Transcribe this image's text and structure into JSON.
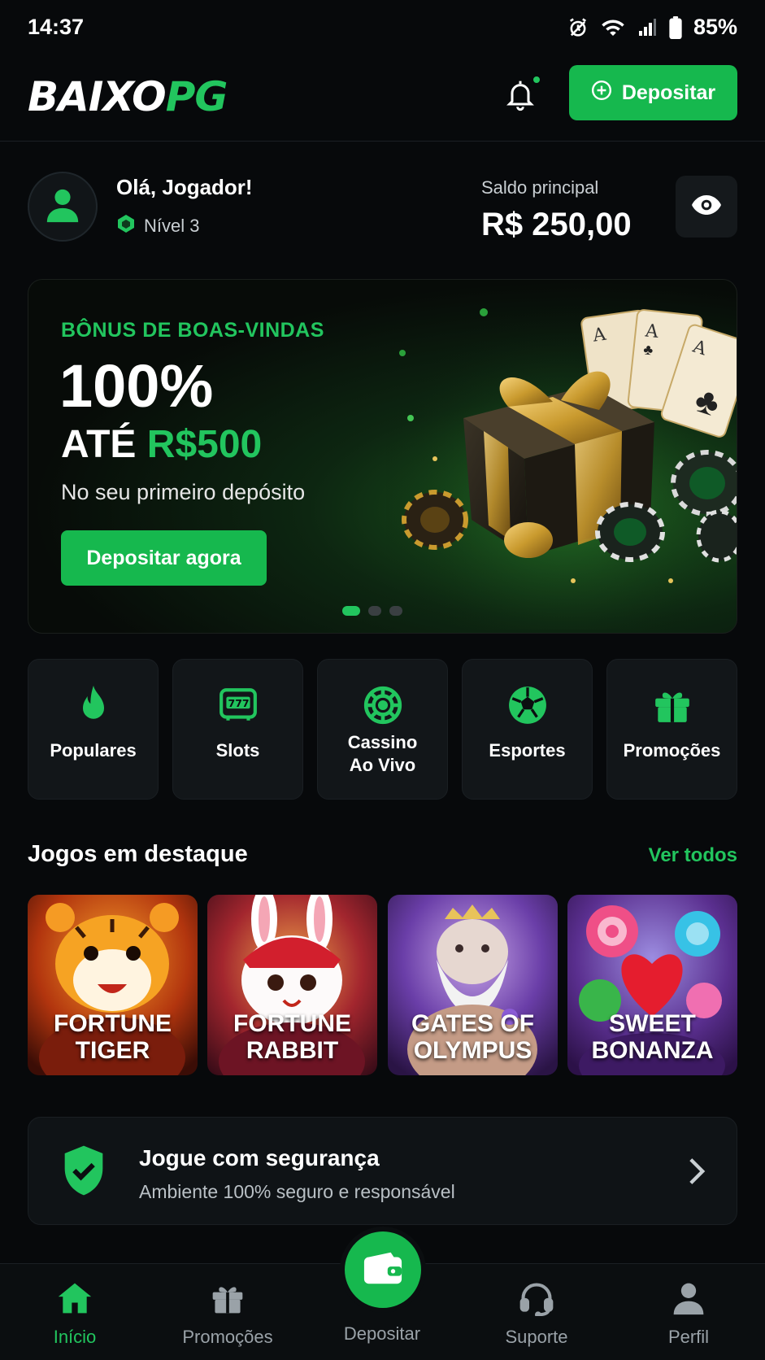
{
  "status_bar": {
    "time": "14:37",
    "battery": "85%"
  },
  "header": {
    "logo_part1": "BAIXO",
    "logo_part2": "PG",
    "deposit_label": "Depositar"
  },
  "user": {
    "greeting": "Olá, Jogador!",
    "level": "Nível 3",
    "balance_label": "Saldo principal",
    "balance_value": "R$ 250,00"
  },
  "banner": {
    "kicker": "BÔNUS DE BOAS-VINDAS",
    "headline": "100%",
    "upto_prefix": "ATÉ",
    "upto_amount": "R$500",
    "subtitle": "No seu primeiro depósito",
    "cta": "Depositar agora",
    "slides": 3,
    "active_slide": 1
  },
  "categories": [
    {
      "label": "Populares",
      "icon": "flame-icon"
    },
    {
      "label": "Slots",
      "icon": "slot-machine-icon"
    },
    {
      "label": "Cassino\nAo Vivo",
      "icon": "roulette-icon"
    },
    {
      "label": "Esportes",
      "icon": "soccer-ball-icon"
    },
    {
      "label": "Promoções",
      "icon": "gift-icon"
    }
  ],
  "featured": {
    "title": "Jogos em destaque",
    "see_all": "Ver todos",
    "games": [
      {
        "name": "FORTUNE\nTIGER"
      },
      {
        "name": "FORTUNE\nRABBIT"
      },
      {
        "name": "GATES OF\nOLYMPUS"
      },
      {
        "name": "SWEET\nBONANZA"
      }
    ]
  },
  "safety": {
    "title": "Jogue com segurança",
    "subtitle": "Ambiente 100% seguro e responsável"
  },
  "bottom_nav": {
    "items": [
      {
        "label": "Início",
        "icon": "home-icon",
        "active": true
      },
      {
        "label": "Promoções",
        "icon": "gift-icon",
        "active": false
      },
      {
        "label": "Depositar",
        "icon": "wallet-icon",
        "active": false
      },
      {
        "label": "Suporte",
        "icon": "headset-icon",
        "active": false
      },
      {
        "label": "Perfil",
        "icon": "user-icon",
        "active": false
      }
    ]
  },
  "colors": {
    "accent": "#22c55e",
    "button": "#16b84e",
    "background": "#07090b",
    "card": "#121619"
  }
}
